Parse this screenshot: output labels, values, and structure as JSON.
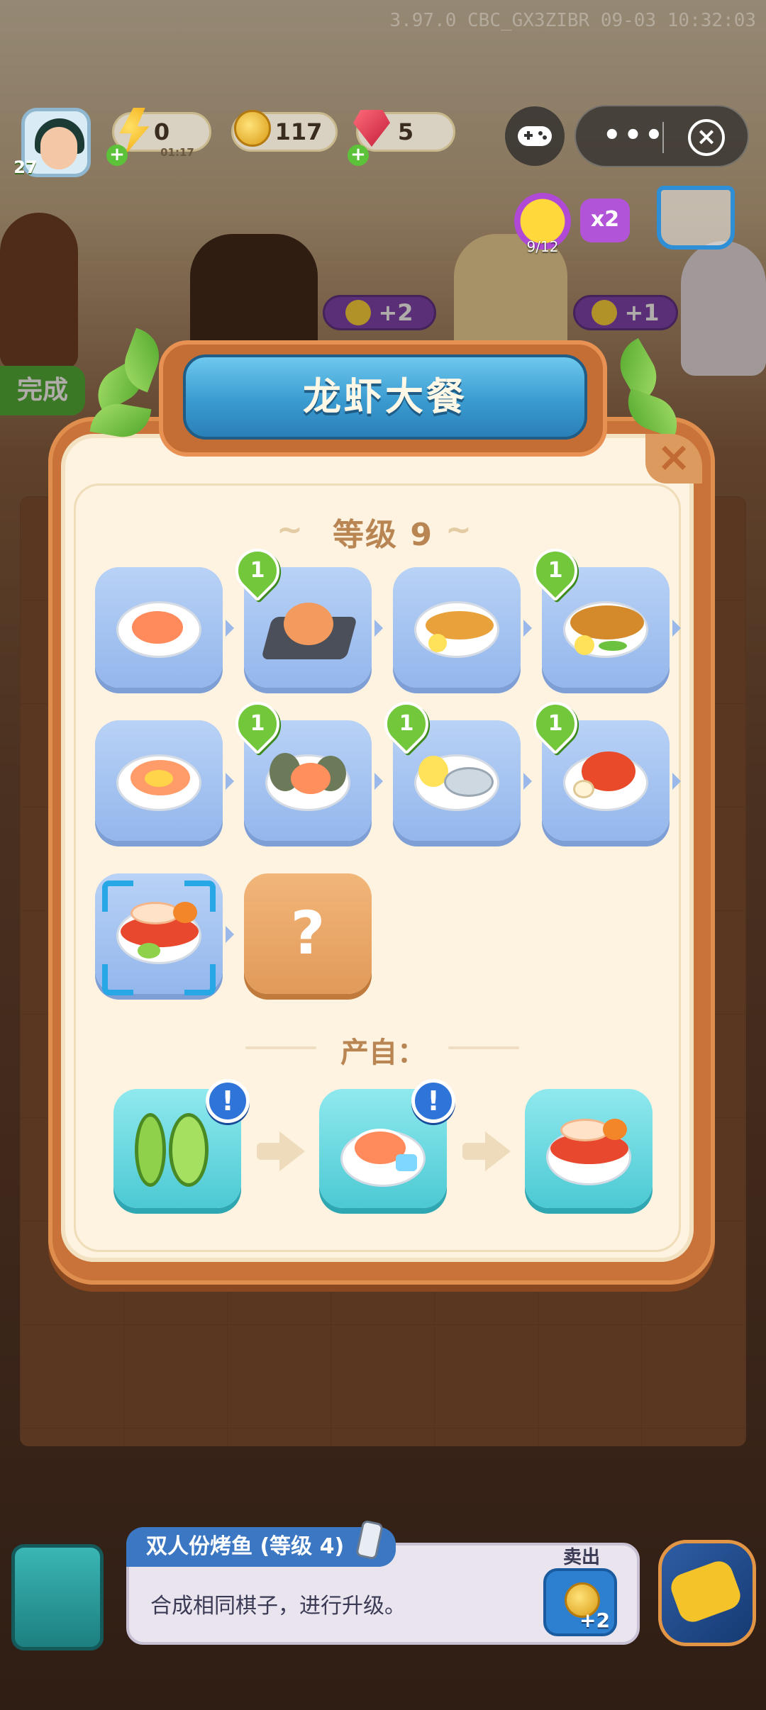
{
  "debug_info": "3.97.0 CBC_GX3ZIBR 09-03 10:32:03",
  "hud": {
    "player_level": "27",
    "energy": "0",
    "energy_timer": "01:17",
    "coins": "117",
    "gems": "5",
    "happiness": "9/12",
    "multiplier": "x2"
  },
  "scene": {
    "done_label": "完成",
    "customer_bonus_1": "+2",
    "customer_bonus_2": "+1"
  },
  "modal": {
    "title": "龙虾大餐",
    "level_label": "等级 9",
    "close_icon": "close-icon",
    "chain": [
      {
        "name": "salmon-steak",
        "badge": null
      },
      {
        "name": "grilled-salmon",
        "badge": "1"
      },
      {
        "name": "fish-plate",
        "badge": null
      },
      {
        "name": "grilled-fish-plate",
        "badge": "1"
      },
      {
        "name": "shrimp-salad",
        "badge": null
      },
      {
        "name": "seafood-mussels",
        "badge": "1"
      },
      {
        "name": "oyster-plate",
        "badge": "1"
      },
      {
        "name": "crab-plate",
        "badge": "1"
      },
      {
        "name": "lobster-feast",
        "badge": null,
        "selected": true
      },
      {
        "name": "unknown",
        "label": "?"
      }
    ],
    "source_label": "产自：",
    "sources": [
      {
        "name": "lime-slices",
        "alert": "!"
      },
      {
        "name": "seafood-platter",
        "alert": "!"
      },
      {
        "name": "lobster-feast",
        "alert": null
      }
    ]
  },
  "info_bar": {
    "item_title": "双人份烤鱼 (等级 4)",
    "description": "合成相同棋子，进行升级。",
    "sell_label": "卖出",
    "sell_amount": "+2"
  },
  "colors": {
    "modal_frame": "#c9733a",
    "title_blue": "#3a9bd0",
    "tile_blue": "#b9d2f6",
    "tile_cyan": "#4cc9d3",
    "badge_green": "#72c83a"
  }
}
